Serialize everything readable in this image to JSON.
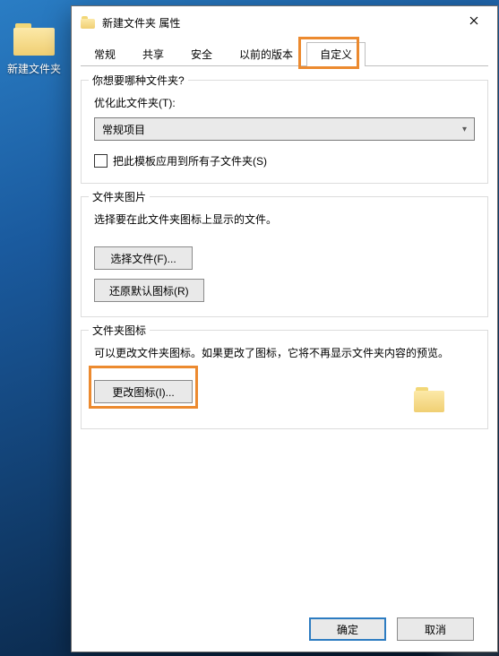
{
  "desktop": {
    "icon_label": "新建文件夹"
  },
  "dialog": {
    "title": "新建文件夹 属性",
    "tabs": {
      "general": "常规",
      "sharing": "共享",
      "security": "安全",
      "previous": "以前的版本",
      "customize": "自定义"
    },
    "group_type": {
      "title": "你想要哪种文件夹?",
      "optimize_label": "优化此文件夹(T):",
      "optimize_value": "常规项目",
      "apply_to_sub": "把此模板应用到所有子文件夹(S)"
    },
    "group_picture": {
      "title": "文件夹图片",
      "desc": "选择要在此文件夹图标上显示的文件。",
      "choose_btn": "选择文件(F)...",
      "restore_btn": "还原默认图标(R)"
    },
    "group_icon": {
      "title": "文件夹图标",
      "desc": "可以更改文件夹图标。如果更改了图标，它将不再显示文件夹内容的预览。",
      "change_btn": "更改图标(I)..."
    },
    "footer": {
      "ok": "确定",
      "cancel": "取消"
    }
  }
}
